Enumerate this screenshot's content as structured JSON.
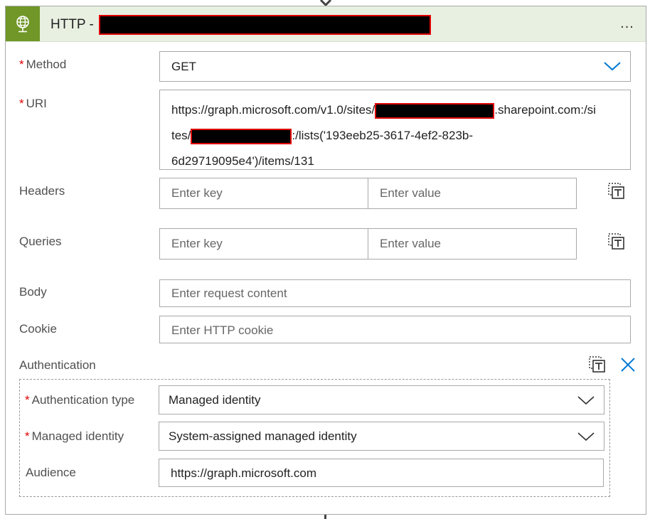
{
  "header": {
    "title": "HTTP -",
    "more_label": "..."
  },
  "fields": {
    "method": {
      "label": "Method",
      "value": "GET"
    },
    "uri": {
      "label": "URI",
      "part1": "https://graph.microsoft.com/v1.0/sites/",
      "part2": ".sharepoint.com:/si",
      "part3": "tes/",
      "part4": ":/lists('193eeb25-3617-4ef2-823b-",
      "part5": "6d29719095e4')/items/131"
    },
    "headers": {
      "label": "Headers",
      "key_placeholder": "Enter key",
      "value_placeholder": "Enter value"
    },
    "queries": {
      "label": "Queries",
      "key_placeholder": "Enter key",
      "value_placeholder": "Enter value"
    },
    "body": {
      "label": "Body",
      "placeholder": "Enter request content"
    },
    "cookie": {
      "label": "Cookie",
      "placeholder": "Enter HTTP cookie"
    }
  },
  "authentication": {
    "label": "Authentication",
    "type": {
      "label": "Authentication type",
      "value": "Managed identity"
    },
    "identity": {
      "label": "Managed identity",
      "value": "System-assigned managed identity"
    },
    "audience": {
      "label": "Audience",
      "value": "https://graph.microsoft.com"
    }
  },
  "colors": {
    "accent": "#0078d4",
    "header_bg": "#e8f0e2",
    "icon_bg": "#709727",
    "required": "#e00000"
  },
  "icons": [
    "globe-icon",
    "more-icon",
    "chevron-down-icon",
    "text-mode-icon",
    "close-icon"
  ]
}
